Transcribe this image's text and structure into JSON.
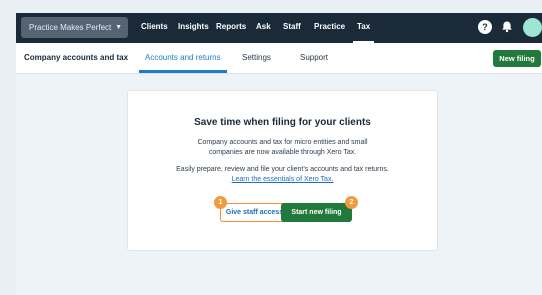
{
  "topbar": {
    "org_name": "Practice Makes Perfect",
    "org_chevron": "▼",
    "nav": [
      "Clients",
      "Insights",
      "Reports",
      "Ask",
      "Staff",
      "Practice",
      "Tax"
    ],
    "active": "Tax",
    "help_icon": "?",
    "bell_icon": "bell-icon"
  },
  "subnav": {
    "title": "Company accounts and tax",
    "tabs": [
      "Accounts and returns",
      "Settings",
      "Support"
    ],
    "active_tab": "Accounts and returns",
    "new_filing_label": "New filing"
  },
  "card": {
    "heading": "Save time when filing for your clients",
    "para1_line1": "Company accounts and tax for micro entities and small",
    "para1_line2": "companies are now available through Xero Tax.",
    "para2_line1": "Easily prepare, review and file your client’s accounts and tax returns.",
    "para2_link": "Learn the essentials of Xero Tax.",
    "give_access_label": "Give staff access",
    "start_filing_label": "Start new filing",
    "marker1": "1",
    "marker2": "2"
  },
  "colors": {
    "topbar": "#1b2a38",
    "accent_blue": "#1e7fc6",
    "primary_green": "#217a3b",
    "marker_orange": "#f29a3c"
  }
}
